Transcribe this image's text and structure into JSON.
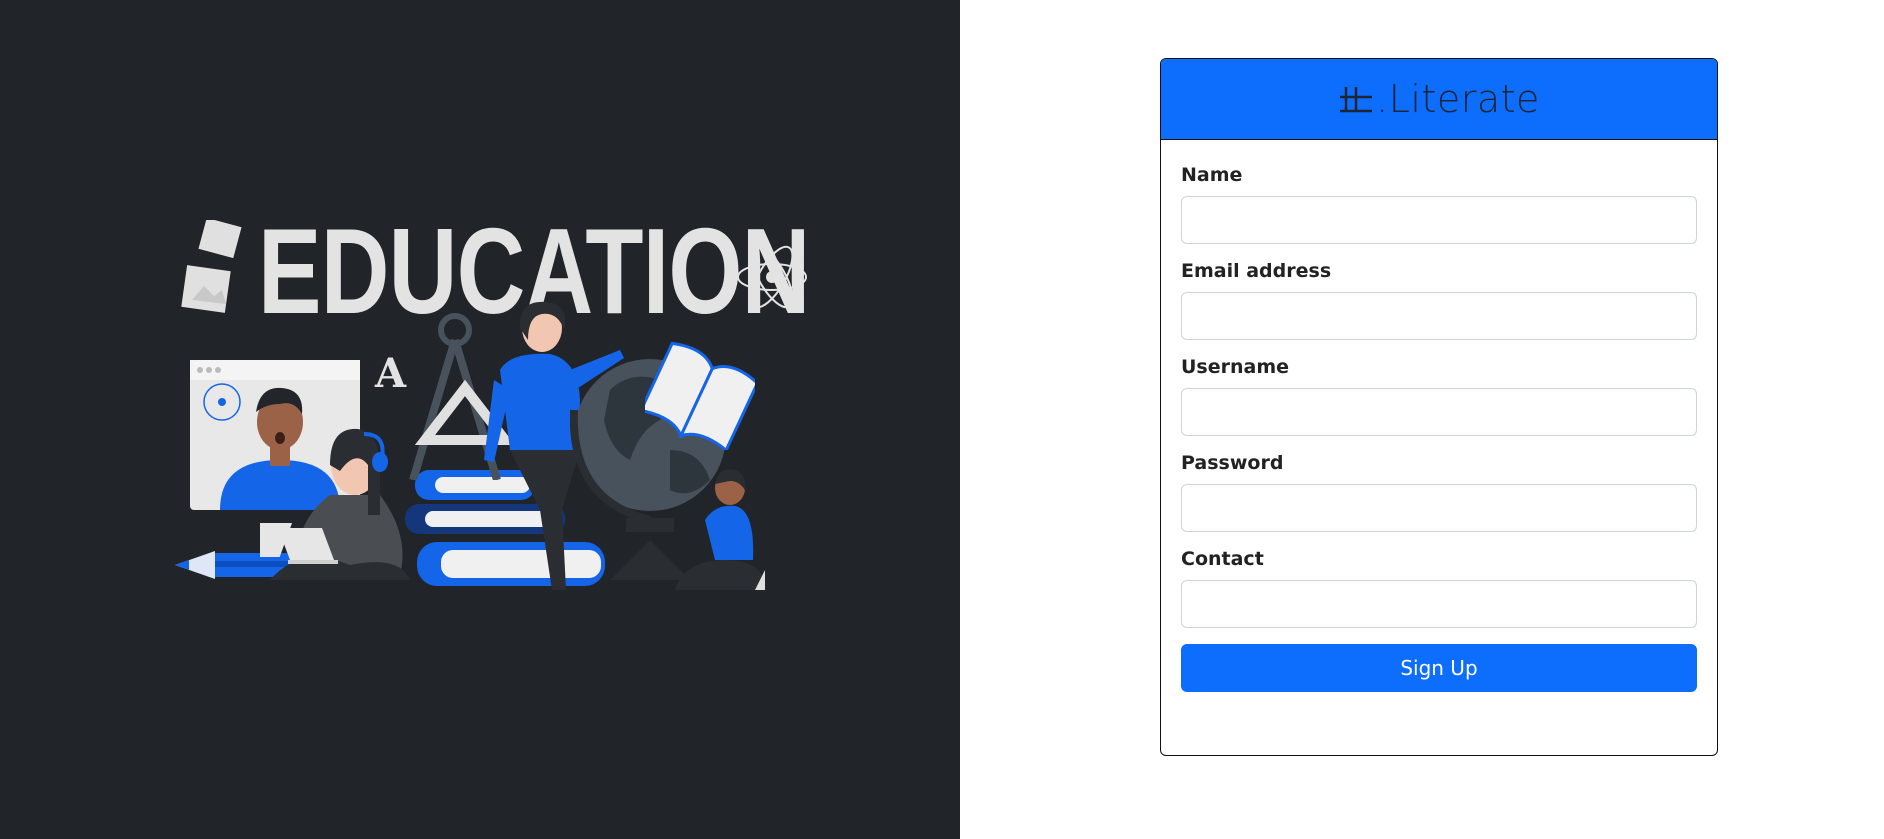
{
  "hero": {
    "word": "EDUCATION",
    "letter": "A"
  },
  "brand": {
    "name": ".Literate"
  },
  "form": {
    "fields": [
      {
        "label": "Name",
        "value": "",
        "placeholder": ""
      },
      {
        "label": "Email address",
        "value": "",
        "placeholder": ""
      },
      {
        "label": "Username",
        "value": "",
        "placeholder": ""
      },
      {
        "label": "Password",
        "value": "",
        "placeholder": ""
      },
      {
        "label": "Contact",
        "value": "",
        "placeholder": ""
      }
    ],
    "submit_label": "Sign Up"
  },
  "colors": {
    "accent": "#0d6efd",
    "dark_panel": "#212529",
    "illustration_blue": "#1565e8"
  },
  "icons": [
    "atom-icon",
    "book-icon",
    "pencil-icon",
    "globe-icon",
    "laptop-icon",
    "headphones-icon",
    "compass-icon",
    "logo-mark-icon"
  ]
}
